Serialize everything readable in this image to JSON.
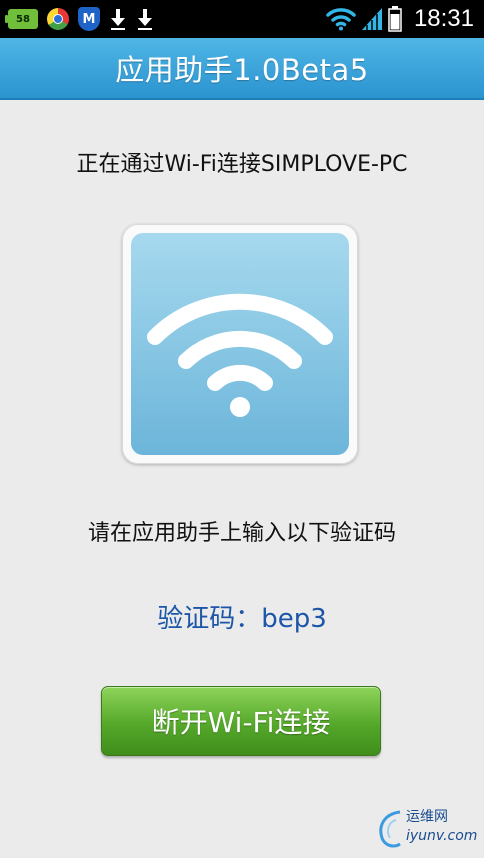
{
  "status_bar": {
    "battery_badge": "58",
    "time": "18:31",
    "icons": [
      "battery-app-icon",
      "chrome-icon",
      "shield-icon",
      "download-icon",
      "download-icon",
      "wifi-icon",
      "signal-icon",
      "battery-icon"
    ]
  },
  "header": {
    "title": "应用助手1.0Beta5"
  },
  "main": {
    "status_message": "正在通过Wi-Fi连接SIMPLOVE-PC",
    "wifi_image_icon": "wifi-icon",
    "instruction": "请在应用助手上输入以下验证码",
    "code_line": "验证码：bep3",
    "disconnect_button": "断开Wi-Fi连接"
  },
  "watermark": {
    "top": "运维网",
    "bottom": "iyunv.com"
  },
  "colors": {
    "header_blue": "#2b93cf",
    "button_green": "#55a82a",
    "code_blue": "#1d56a8",
    "tile_blue": "#6cb5da"
  }
}
